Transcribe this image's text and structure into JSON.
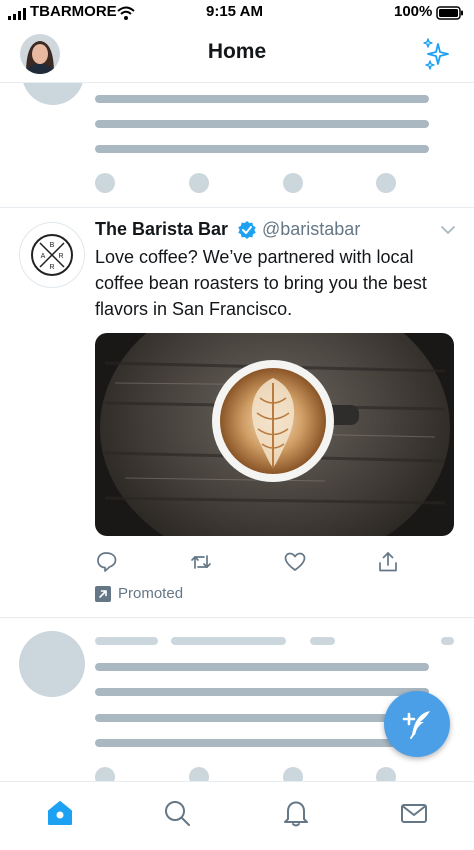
{
  "status_bar": {
    "carrier": "TBARMORE",
    "time": "9:15 AM",
    "battery": "100%",
    "icons": [
      "signal-icon",
      "wifi-icon",
      "battery-icon"
    ]
  },
  "header": {
    "title": "Home",
    "left_icon": "profile-avatar",
    "right_icon": "sparkle-icon"
  },
  "tweet": {
    "name": "The Barista Bar",
    "handle": "@baristabar",
    "verified": true,
    "text": "Love coffee? We’ve partnered with local coffee bean roasters to bring you the best flavors in San Francisco.",
    "logo_letters": [
      "B",
      "A",
      "R",
      "R"
    ],
    "actions": [
      "reply-icon",
      "retweet-icon",
      "like-icon",
      "share-icon"
    ],
    "promoted_label": "Promoted"
  },
  "fab": {
    "icon": "compose-tweet-icon"
  },
  "tab_bar": {
    "tabs": [
      "home-icon",
      "search-icon",
      "notifications-icon",
      "messages-icon"
    ],
    "active": "home-icon"
  },
  "colors": {
    "accent": "#1da1f2",
    "fab": "#4a9fe7",
    "skeleton_dark": "#aab8c2",
    "skeleton_light": "#ccd6dd",
    "secondary_text": "#657786"
  }
}
